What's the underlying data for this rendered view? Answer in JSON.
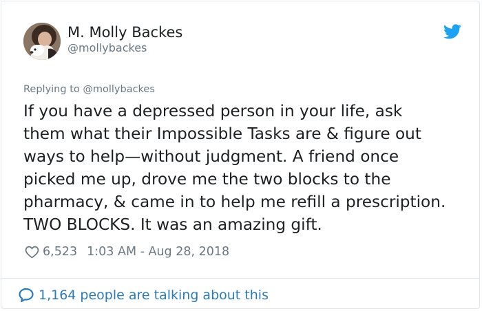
{
  "author": {
    "display_name": "M. Molly Backes",
    "handle": "@mollybackes"
  },
  "reply_context": "Replying to @mollybackes",
  "tweet": {
    "lines": [
      "If you have a depressed person in your life, ask",
      "them what their Impossible Tasks are & figure out",
      "ways to help—without judgment. A friend once",
      "picked me up, drove me the two blocks to the",
      "pharmacy, & came in to help me refill a prescription.",
      "TWO BLOCKS. It was an amazing gift."
    ],
    "likes": "6,523",
    "timestamp": "1:03 AM - Aug 28, 2018"
  },
  "conversation": {
    "label": "1,164 people are talking about this"
  },
  "icons": {
    "brand": "twitter-bird-icon",
    "like": "heart-icon",
    "conversation": "speech-bubble-icon"
  },
  "colors": {
    "twitter_blue": "#1da1f2",
    "link_blue": "#2b7bb9",
    "secondary_text": "#697882",
    "primary_text": "#1c2022",
    "border": "#e1e8ed"
  }
}
